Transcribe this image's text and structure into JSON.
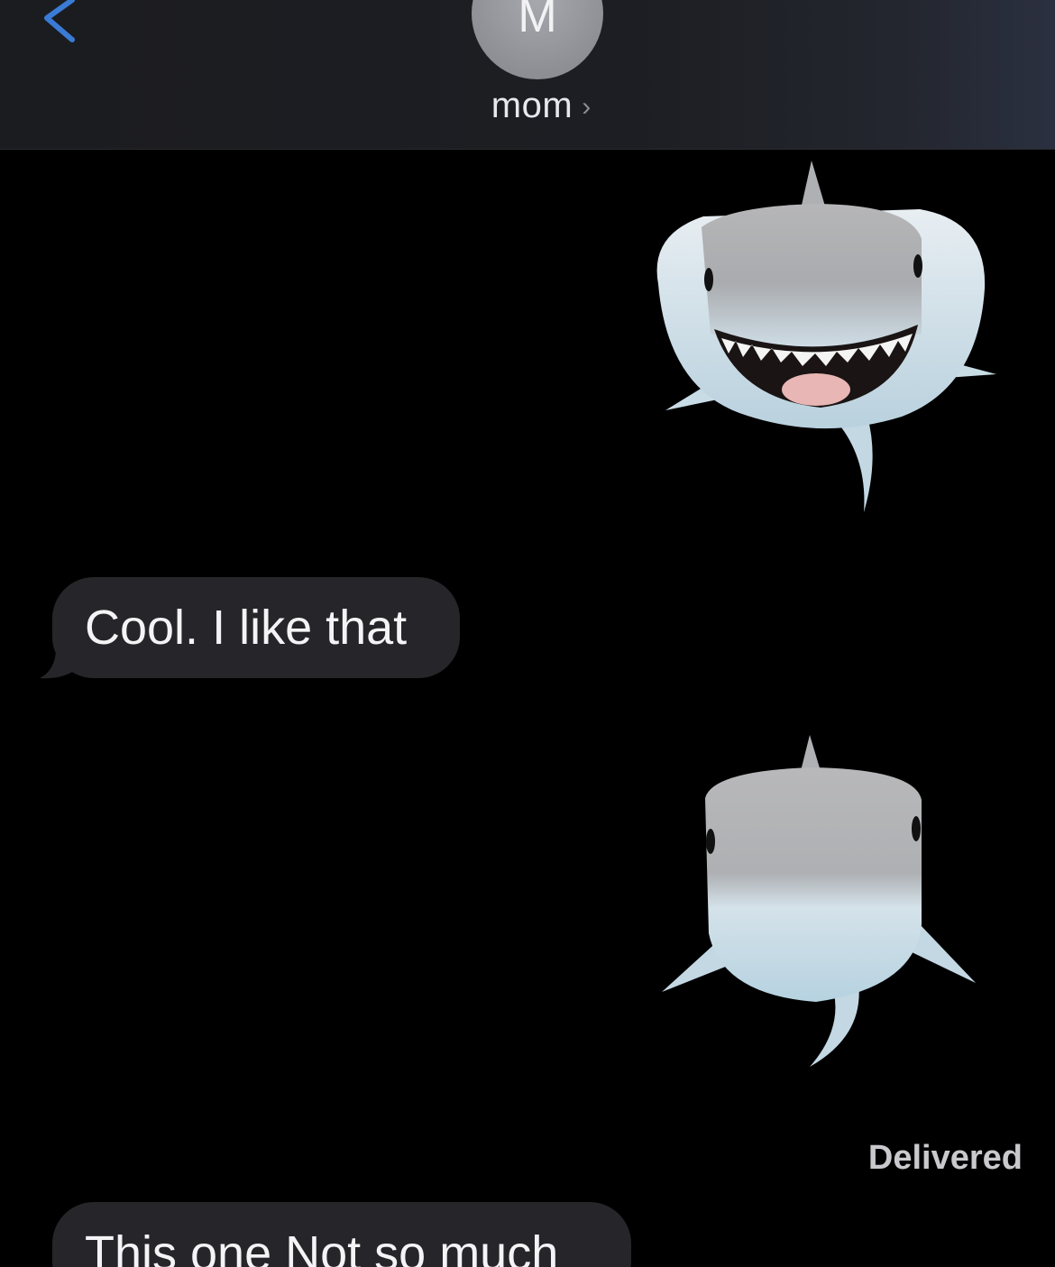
{
  "header": {
    "avatar_initial": "M",
    "contact_name": "mom",
    "chevron": "›",
    "back_icon": "chevron-left-icon"
  },
  "messages": [
    {
      "type": "memoji",
      "direction": "outgoing",
      "sticker": "shark-smiling"
    },
    {
      "type": "text",
      "direction": "incoming",
      "text": "Cool. I like that"
    },
    {
      "type": "memoji",
      "direction": "outgoing",
      "sticker": "shark-neutral"
    },
    {
      "type": "text",
      "direction": "incoming",
      "text": "This one Not so much"
    }
  ],
  "status": {
    "text": "Delivered"
  },
  "colors": {
    "background": "#000000",
    "header_bg": "#1d1e23",
    "incoming_bubble": "#26262a",
    "back_accent": "#3a7bd5",
    "avatar_bg": "#8e8f95"
  }
}
